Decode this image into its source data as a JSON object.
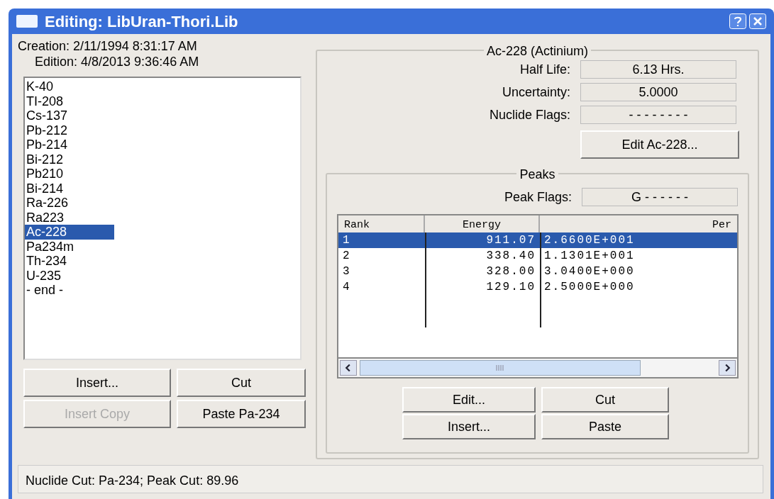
{
  "window": {
    "title": "Editing: LibUran-Thori.Lib"
  },
  "creation": "Creation: 2/11/1994  8:31:17 AM",
  "edition": "Edition: 4/8/2013  9:36:46 AM",
  "nuclides": [
    {
      "label": "K-40",
      "selected": false
    },
    {
      "label": "TI-208",
      "selected": false
    },
    {
      "label": "Cs-137",
      "selected": false
    },
    {
      "label": "Pb-212",
      "selected": false
    },
    {
      "label": "Pb-214",
      "selected": false
    },
    {
      "label": "Bi-212",
      "selected": false
    },
    {
      "label": "Pb210",
      "selected": false
    },
    {
      "label": "Bi-214",
      "selected": false
    },
    {
      "label": "Ra-226",
      "selected": false
    },
    {
      "label": "Ra223",
      "selected": false
    },
    {
      "label": "Ac-228",
      "selected": true
    },
    {
      "label": "Pa234m",
      "selected": false
    },
    {
      "label": "Th-234",
      "selected": false
    },
    {
      "label": "U-235",
      "selected": false
    },
    {
      "label": "- end -",
      "selected": false
    }
  ],
  "left_buttons": [
    {
      "label": "Insert...",
      "disabled": false
    },
    {
      "label": "Cut",
      "disabled": false
    },
    {
      "label": "Insert Copy",
      "disabled": true
    },
    {
      "label": "Paste Pa-234",
      "disabled": false
    }
  ],
  "nuclide_group": {
    "title": "Ac-228 (Actinium)",
    "fields": [
      {
        "label": "Half Life:",
        "value": "6.13 Hrs."
      },
      {
        "label": "Uncertainty:",
        "value": "5.0000"
      },
      {
        "label": "Nuclide Flags:",
        "value": "- - - - - - - -"
      }
    ],
    "edit_button": "Edit Ac-228..."
  },
  "peaks_group": {
    "title": "Peaks",
    "peak_flags": {
      "label": "Peak Flags:",
      "value": "G - - - - - -"
    },
    "table": {
      "columns": [
        "Rank",
        "Energy",
        "Per"
      ],
      "rows": [
        {
          "cells": [
            "1",
            "911.07",
            "2.6600E+001"
          ],
          "selected": true
        },
        {
          "cells": [
            "2",
            "338.40",
            "1.1301E+001"
          ],
          "selected": false
        },
        {
          "cells": [
            "3",
            "328.00",
            "3.0400E+000"
          ],
          "selected": false
        },
        {
          "cells": [
            "4",
            "129.10",
            "2.5000E+000"
          ],
          "selected": false
        }
      ]
    },
    "buttons": [
      "Edit...",
      "Cut",
      "Insert...",
      "Paste"
    ]
  },
  "status_bar": "Nuclide Cut: Pa-234; Peak Cut: 89.96"
}
